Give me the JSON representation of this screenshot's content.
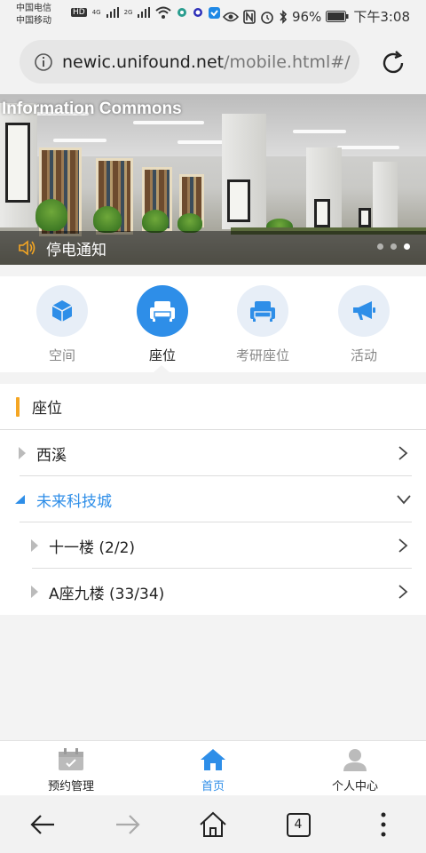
{
  "statusbar": {
    "carrier_1": "中国电信",
    "carrier_2": "中国移动",
    "hd": "HD",
    "net_1": "4G",
    "net_2": "2G",
    "battery": "96%",
    "time": "下午3:08"
  },
  "address": {
    "url_host": "newic.unifound.net",
    "url_path": "/mobile.html#/"
  },
  "banner": {
    "title": "Information Commons",
    "notice": "停电通知",
    "slide_count": 3,
    "active_slide": 3
  },
  "tabs": [
    {
      "label": "空间",
      "icon": "cube-icon",
      "active": false
    },
    {
      "label": "座位",
      "icon": "armchair-icon",
      "active": true
    },
    {
      "label": "考研座位",
      "icon": "armchair-icon",
      "active": false
    },
    {
      "label": "活动",
      "icon": "megaphone-icon",
      "active": false
    }
  ],
  "seat_list": {
    "title": "座位",
    "items": [
      {
        "label": "西溪",
        "expanded": false,
        "level": 0
      },
      {
        "label": "未来科技城",
        "expanded": true,
        "level": 0
      },
      {
        "label": "十一楼 (2/2)",
        "expanded": false,
        "level": 1
      },
      {
        "label": "A座九楼 (33/34)",
        "expanded": false,
        "level": 1
      }
    ]
  },
  "bottom_nav": [
    {
      "label": "预约管理",
      "icon": "calendar-icon",
      "active": false
    },
    {
      "label": "首页",
      "icon": "home-icon",
      "active": true
    },
    {
      "label": "个人中心",
      "icon": "user-icon",
      "active": false
    }
  ],
  "toolbar": {
    "tab_count": "4"
  },
  "colors": {
    "accent_blue": "#2e8ee8",
    "accent_orange": "#f5a623",
    "light_blue": "#e7eef7"
  }
}
